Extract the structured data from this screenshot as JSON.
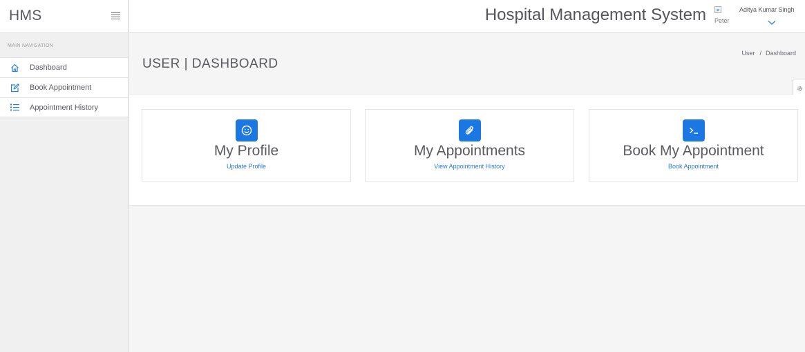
{
  "sidebar": {
    "brand": "HMS",
    "nav_header": "MAIN NAVIGATION",
    "items": [
      {
        "label": "Dashboard",
        "icon": "home-icon"
      },
      {
        "label": "Book Appointment",
        "icon": "edit-icon"
      },
      {
        "label": "Appointment History",
        "icon": "list-icon"
      }
    ]
  },
  "header": {
    "title": "Hospital Management System",
    "avatar_alt": "Peter",
    "user_name": "Aditya Kumar Singh"
  },
  "page": {
    "title": "USER | DASHBOARD",
    "breadcrumb": [
      "User",
      "Dashboard"
    ],
    "breadcrumb_separator": "/"
  },
  "cards": [
    {
      "title": "My Profile",
      "link": "Update Profile",
      "icon": "smile-icon"
    },
    {
      "title": "My Appointments",
      "link": "View Appointment History",
      "icon": "paperclip-icon"
    },
    {
      "title": "Book My Appointment",
      "link": "Book Appointment",
      "icon": "terminal-icon"
    }
  ],
  "colors": {
    "accent": "#1b78e2",
    "link": "#2a7bd8",
    "sidebar_bg": "#f0f0f1",
    "page_bg": "#f5f5f6"
  }
}
